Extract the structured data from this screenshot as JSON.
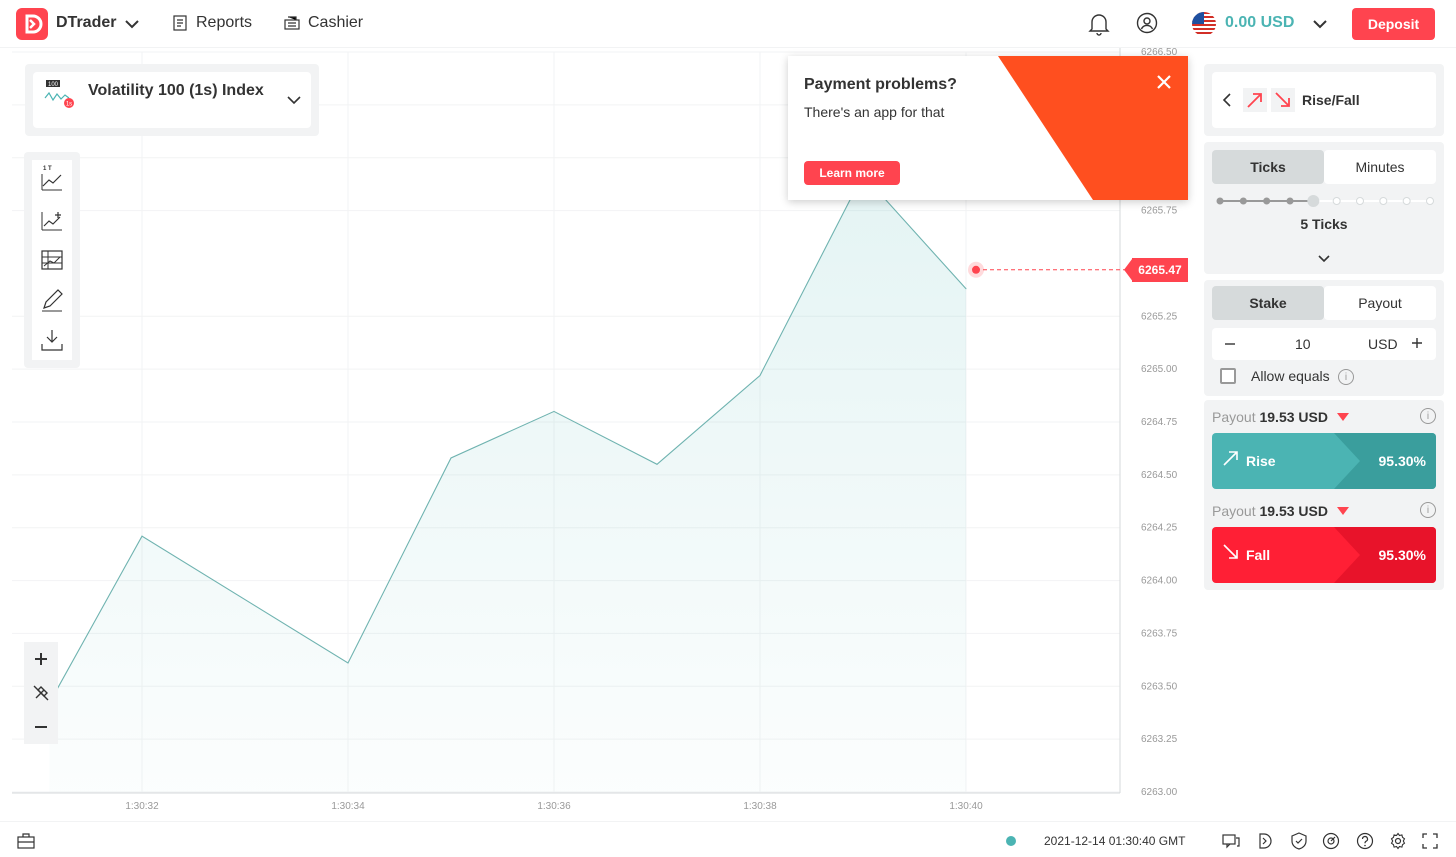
{
  "header": {
    "brand": "DTrader",
    "nav": [
      {
        "label": "Reports"
      },
      {
        "label": "Cashier"
      }
    ],
    "balance": "0.00 USD",
    "deposit_label": "Deposit"
  },
  "symbol": {
    "name": "Volatility 100 (1s) Index",
    "icon_badge": "100",
    "icon_sub": "1s"
  },
  "toolbar": {
    "chart_type_label": "1 T"
  },
  "chart_data": {
    "type": "area",
    "x_ticks": [
      "1:30:32",
      "1:30:34",
      "1:30:36",
      "1:30:38",
      "1:30:40"
    ],
    "y_ticks": [
      "6266.50",
      "6265.75",
      "6265.25",
      "6265.00",
      "6264.75",
      "6264.50",
      "6264.25",
      "6264.00",
      "6263.75",
      "6263.50",
      "6263.25",
      "6263.00"
    ],
    "x_seconds": [
      31.1,
      32,
      34,
      35,
      36,
      37,
      38,
      39,
      40
    ],
    "values": [
      6263.42,
      6264.21,
      6263.61,
      6264.58,
      6264.8,
      6264.55,
      6264.97,
      6265.92,
      6265.38
    ],
    "current_price": "6265.47",
    "ylim": [
      6263.0,
      6266.5
    ]
  },
  "popup": {
    "title": "Payment problems?",
    "subtitle": "There's an app for that",
    "button": "Learn more"
  },
  "trade": {
    "trade_type": "Rise/Fall",
    "duration_tabs": [
      "Ticks",
      "Minutes"
    ],
    "ticks_label": "5 Ticks",
    "ticks_selected": 5,
    "basis_tabs": [
      "Stake",
      "Payout"
    ],
    "stake_value": "10",
    "currency": "USD",
    "allow_equals": "Allow equals",
    "payout_prefix": "Payout",
    "rise": {
      "payout": "19.53 USD",
      "label": "Rise",
      "pct": "95.30%"
    },
    "fall": {
      "payout": "19.53 USD",
      "label": "Fall",
      "pct": "95.30%"
    }
  },
  "footer": {
    "datetime": "2021-12-14 01:30:40 GMT"
  },
  "colors": {
    "brand": "#ff444f",
    "rise": "#4bb4b3",
    "fall": "#ec3f3f",
    "orange": "#ff4f1f"
  }
}
